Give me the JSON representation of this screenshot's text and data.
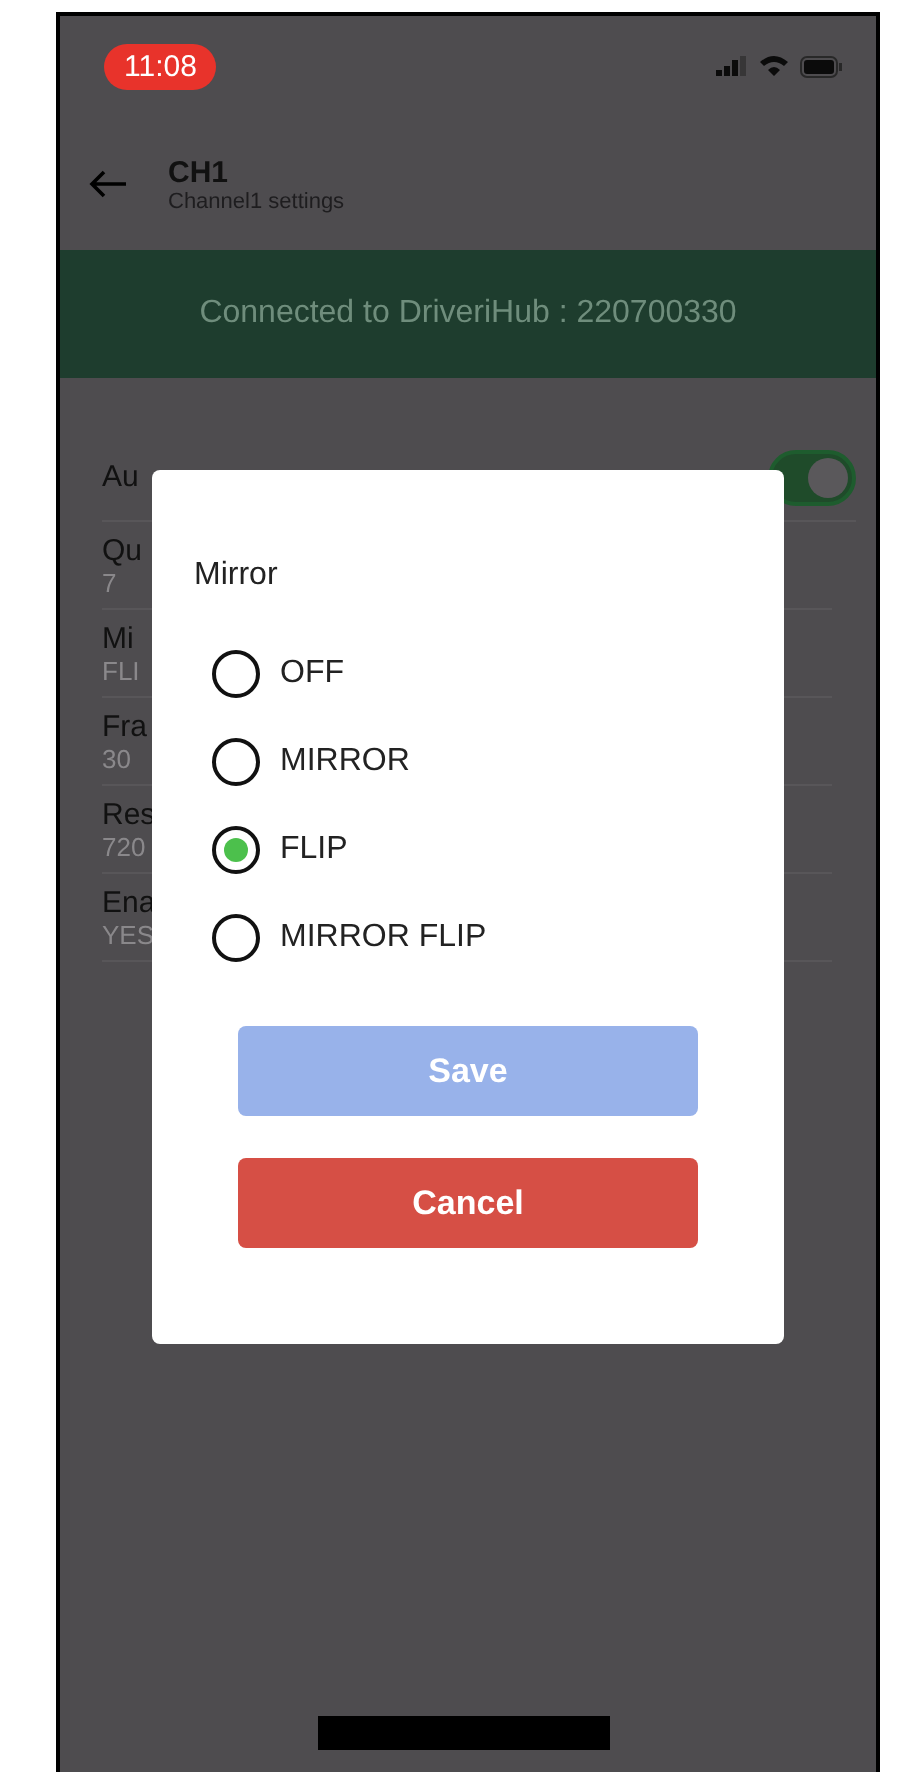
{
  "status_bar": {
    "time": "11:08"
  },
  "header": {
    "title": "CH1",
    "subtitle": "Channel1 settings"
  },
  "banner": {
    "text": "Connected to DriveriHub : 220700330"
  },
  "settings": [
    {
      "kind": "toggle",
      "label": "Au",
      "on": true
    },
    {
      "kind": "value",
      "label": "Qu",
      "value": "7"
    },
    {
      "kind": "value",
      "label": "Mi",
      "value": "FLI"
    },
    {
      "kind": "value",
      "label": "Fra",
      "value": "30"
    },
    {
      "kind": "value",
      "label": "Res",
      "value": "720"
    },
    {
      "kind": "value",
      "label": "Ena",
      "value": "YES"
    }
  ],
  "dialog": {
    "title": "Mirror",
    "options": [
      {
        "label": "OFF",
        "selected": false
      },
      {
        "label": "MIRROR",
        "selected": false
      },
      {
        "label": "FLIP",
        "selected": true
      },
      {
        "label": "MIRROR FLIP",
        "selected": false
      }
    ],
    "buttons": [
      {
        "kind": "primary",
        "label": "Save",
        "disabled": true
      },
      {
        "kind": "danger",
        "label": "Cancel",
        "disabled": false
      }
    ]
  }
}
